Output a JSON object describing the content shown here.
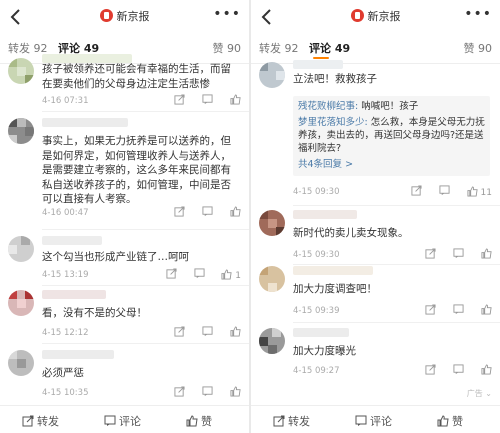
{
  "left": {
    "brand": "新京报",
    "tabs": {
      "forward": "转发 92",
      "comments": "评论 49",
      "likes": "赞 90"
    },
    "comments": [
      {
        "text": "孩子被领养还可能会有幸福的生活，而留在要卖他们的父母身边注定生活悲惨",
        "time": "4-16 07:31",
        "likes": ""
      },
      {
        "text": "事实上，如果无力抚养是可以送养的，但是如何界定，如何管理收养人与送养人，是需要建立考察的，这么多年来民间都有私自送收养孩子的，如何管理，中间是否可以直接有人考察。",
        "time": "4-16 00:47",
        "likes": ""
      },
      {
        "text": "这个勾当也形成产业链了…呵呵",
        "time": "4-15 13:19",
        "likes": "1"
      },
      {
        "text": "看，没有不是的父母！",
        "time": "4-15 12:12",
        "likes": ""
      },
      {
        "text": "必须严惩",
        "time": "4-15 10:35",
        "likes": ""
      }
    ],
    "bottom": {
      "forward": "转发",
      "comment": "评论",
      "like": "赞"
    }
  },
  "right": {
    "brand": "新京报",
    "tabs": {
      "forward": "转发 92",
      "comments": "评论 49",
      "likes": "赞 90"
    },
    "first_comment": "立法吧！救救孩子",
    "replies": [
      {
        "who": "残花败柳纪事:",
        "text": " 呐喊吧！孩子"
      },
      {
        "who": "梦里花落知多少:",
        "text": " 怎么救，本身是父母无力抚养孩，卖出去的，再送回父母身边吗?还是送福利院去?"
      }
    ],
    "more_replies": "共4条回复 >",
    "first_time": "4-15 09:30",
    "first_likes": "11",
    "comments": [
      {
        "text": "新时代的卖儿卖女现象。",
        "time": "4-15 09:30",
        "likes": ""
      },
      {
        "text": "加大力度调查吧！",
        "time": "4-15 09:39",
        "likes": ""
      },
      {
        "text": "加大力度曝光",
        "time": "4-15 09:27",
        "likes": ""
      }
    ],
    "ad": "广告",
    "bottom": {
      "forward": "转发",
      "comment": "评论",
      "like": "赞"
    }
  },
  "colors": {
    "accent": "#ff8200",
    "link": "#4a7aa8",
    "brand": "#e03b2f"
  }
}
